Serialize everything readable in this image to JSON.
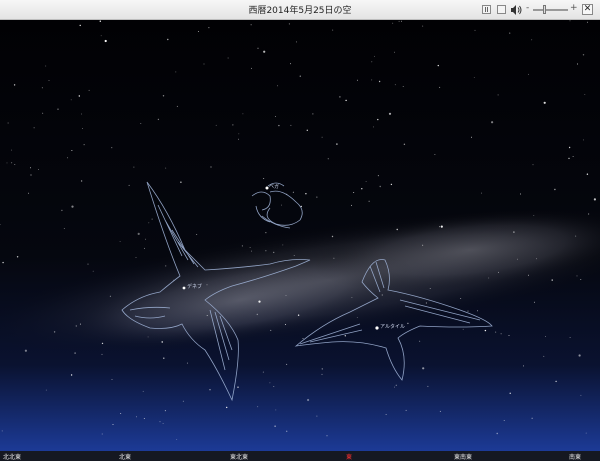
{
  "window": {
    "title": "西暦2014年5月25日の空",
    "close_label": "✕",
    "volume_minus": "-",
    "volume_plus": "+"
  },
  "icons": {
    "pause": "pause-icon",
    "window": "window-icon",
    "volume": "speaker-icon",
    "close": "close-icon"
  },
  "sky": {
    "star_labels": {
      "deneb": "デネブ",
      "altair": "アルタイル",
      "vega": "ベガ"
    }
  },
  "compass": {
    "labels": [
      "北北東",
      "北東",
      "東北東",
      "東",
      "東南東",
      "南東"
    ],
    "highlight": "東"
  },
  "colors": {
    "highlight_direction": "#ff3131",
    "constellation_lines": "#9fb2d6"
  }
}
